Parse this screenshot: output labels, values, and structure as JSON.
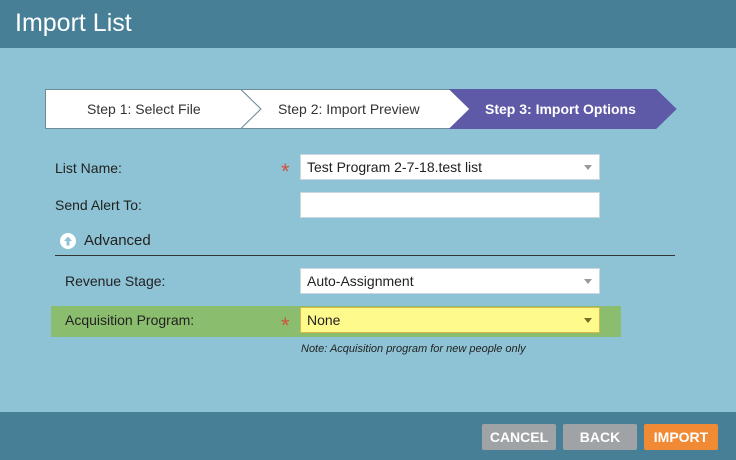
{
  "dialog": {
    "title": "Import List"
  },
  "wizard": {
    "steps": [
      {
        "label": "Step 1: Select File",
        "active": false
      },
      {
        "label": "Step 2: Import Preview",
        "active": false
      },
      {
        "label": "Step 3: Import Options",
        "active": true
      }
    ]
  },
  "form": {
    "list_name": {
      "label": "List Name:",
      "value": "Test Program 2-7-18.test list",
      "required_mark": "*"
    },
    "send_alert": {
      "label": "Send Alert To:",
      "value": ""
    },
    "advanced": {
      "label": "Advanced",
      "icon": "arrow-up-circle-icon"
    },
    "revenue_stage": {
      "label": "Revenue Stage:",
      "value": "Auto-Assignment"
    },
    "acquisition_program": {
      "label": "Acquisition Program:",
      "value": "None",
      "required_mark": "*",
      "note": "Note: Acquisition program for new people only"
    }
  },
  "buttons": {
    "cancel": "CANCEL",
    "back": "BACK",
    "import": "IMPORT"
  },
  "colors": {
    "header": "#477f96",
    "content_bg": "#8ec3d5",
    "active_step": "#5e5aa8",
    "required": "#d0533f",
    "highlight_row": "#8bbd6e",
    "highlight_field": "#fffa8c",
    "primary_button": "#f08a35",
    "secondary_button": "#9fa3a5"
  }
}
